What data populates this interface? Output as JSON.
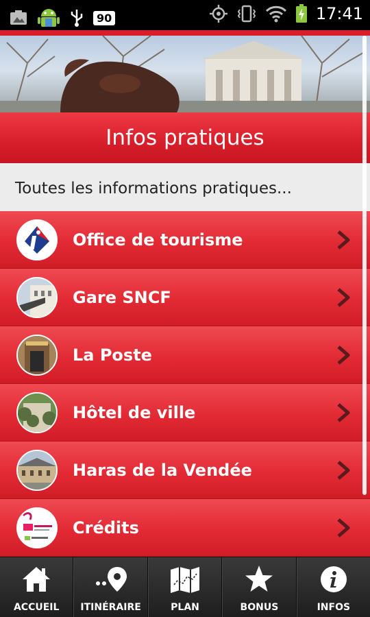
{
  "status_bar": {
    "battery_level": "90",
    "time": "17:41"
  },
  "header": {
    "title": "Infos pratiques"
  },
  "subtitle": "Toutes les informations pratiques...",
  "items": [
    {
      "label": "Office de tourisme",
      "icon": "tourism-info-icon"
    },
    {
      "label": "Gare SNCF",
      "icon": "train-station-photo"
    },
    {
      "label": "La Poste",
      "icon": "post-office-photo"
    },
    {
      "label": "Hôtel de ville",
      "icon": "town-hall-photo"
    },
    {
      "label": "Haras de la Vendée",
      "icon": "stud-farm-photo"
    },
    {
      "label": "Crédits",
      "icon": "credits-logo"
    }
  ],
  "tabs": [
    {
      "label": "ACCUEIL",
      "icon": "home-icon"
    },
    {
      "label": "ITINÉRAIRE",
      "icon": "route-pin-icon"
    },
    {
      "label": "PLAN",
      "icon": "map-icon"
    },
    {
      "label": "BONUS",
      "icon": "star-icon"
    },
    {
      "label": "INFOS",
      "icon": "info-icon"
    }
  ],
  "colors": {
    "accent": "#d71e2a",
    "tabbar": "#2a2a2a"
  }
}
